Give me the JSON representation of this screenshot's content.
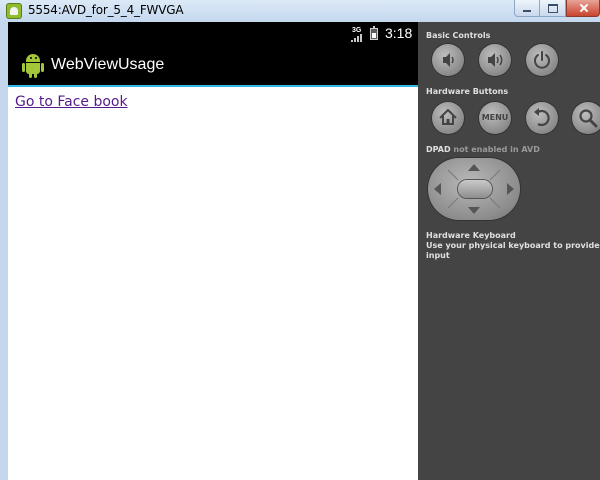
{
  "window": {
    "title": "5554:AVD_for_5_4_FWVGA"
  },
  "device": {
    "status_bar": {
      "network": "3G",
      "time": "3:18"
    },
    "action_bar": {
      "app_title": "WebViewUsage",
      "icon": "android-robot-icon"
    },
    "webview": {
      "link_text": "Go to Face book"
    }
  },
  "controls": {
    "basic_controls_label": "Basic Controls",
    "basic_controls": [
      "volume-down-icon",
      "volume-up-icon",
      "power-icon"
    ],
    "hardware_buttons_label": "Hardware Buttons",
    "hardware_buttons": [
      "home-icon",
      "menu-button",
      "back-icon",
      "search-icon"
    ],
    "menu_label": "MENU",
    "dpad_label": "DPAD",
    "dpad_note": "not enabled in AVD",
    "keyboard_label": "Hardware Keyboard",
    "keyboard_note": "Use your physical keyboard to provide input"
  },
  "colors": {
    "action_bar_accent": "#33b5e5",
    "panel_background": "#444444",
    "link_visited": "#551a8b"
  }
}
